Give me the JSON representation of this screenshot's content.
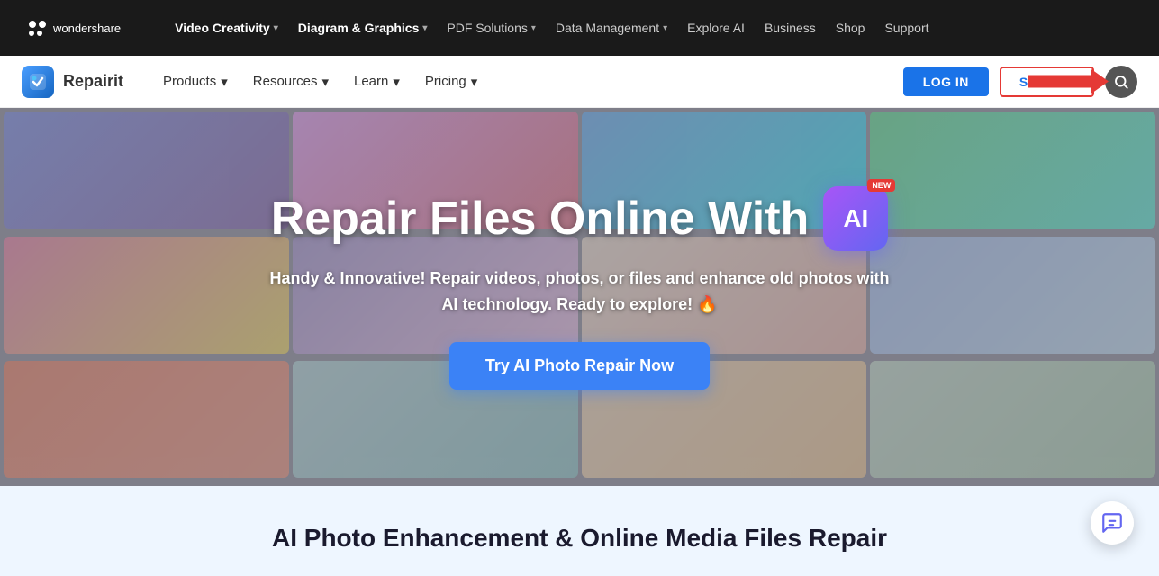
{
  "topNav": {
    "brand": "wondershare",
    "items": [
      {
        "label": "Video Creativity",
        "hasChevron": true
      },
      {
        "label": "Diagram & Graphics",
        "hasChevron": true
      },
      {
        "label": "PDF Solutions",
        "hasChevron": true
      },
      {
        "label": "Data Management",
        "hasChevron": true
      },
      {
        "label": "Explore AI",
        "hasChevron": false
      },
      {
        "label": "Business",
        "hasChevron": false
      },
      {
        "label": "Shop",
        "hasChevron": false
      },
      {
        "label": "Support",
        "hasChevron": false
      }
    ]
  },
  "secNav": {
    "brand": "Repairit",
    "items": [
      {
        "label": "Products",
        "hasChevron": true
      },
      {
        "label": "Resources",
        "hasChevron": true
      },
      {
        "label": "Learn",
        "hasChevron": true
      },
      {
        "label": "Pricing",
        "hasChevron": true
      }
    ],
    "loginLabel": "LOG IN",
    "signupLabel": "SIGN UP"
  },
  "hero": {
    "titlePart1": "Repair Files Online With",
    "aiBadgeText": "AI",
    "newBadge": "NEW",
    "subtitle": "Handy & Innovative! Repair videos, photos, or files and enhance old photos with AI technology. Ready to explore! 🔥",
    "ctaButton": "Try AI Photo Repair Now"
  },
  "bottom": {
    "title": "AI Photo Enhancement & Online Media Files Repair"
  },
  "chatBubble": {
    "label": "chat-support"
  }
}
